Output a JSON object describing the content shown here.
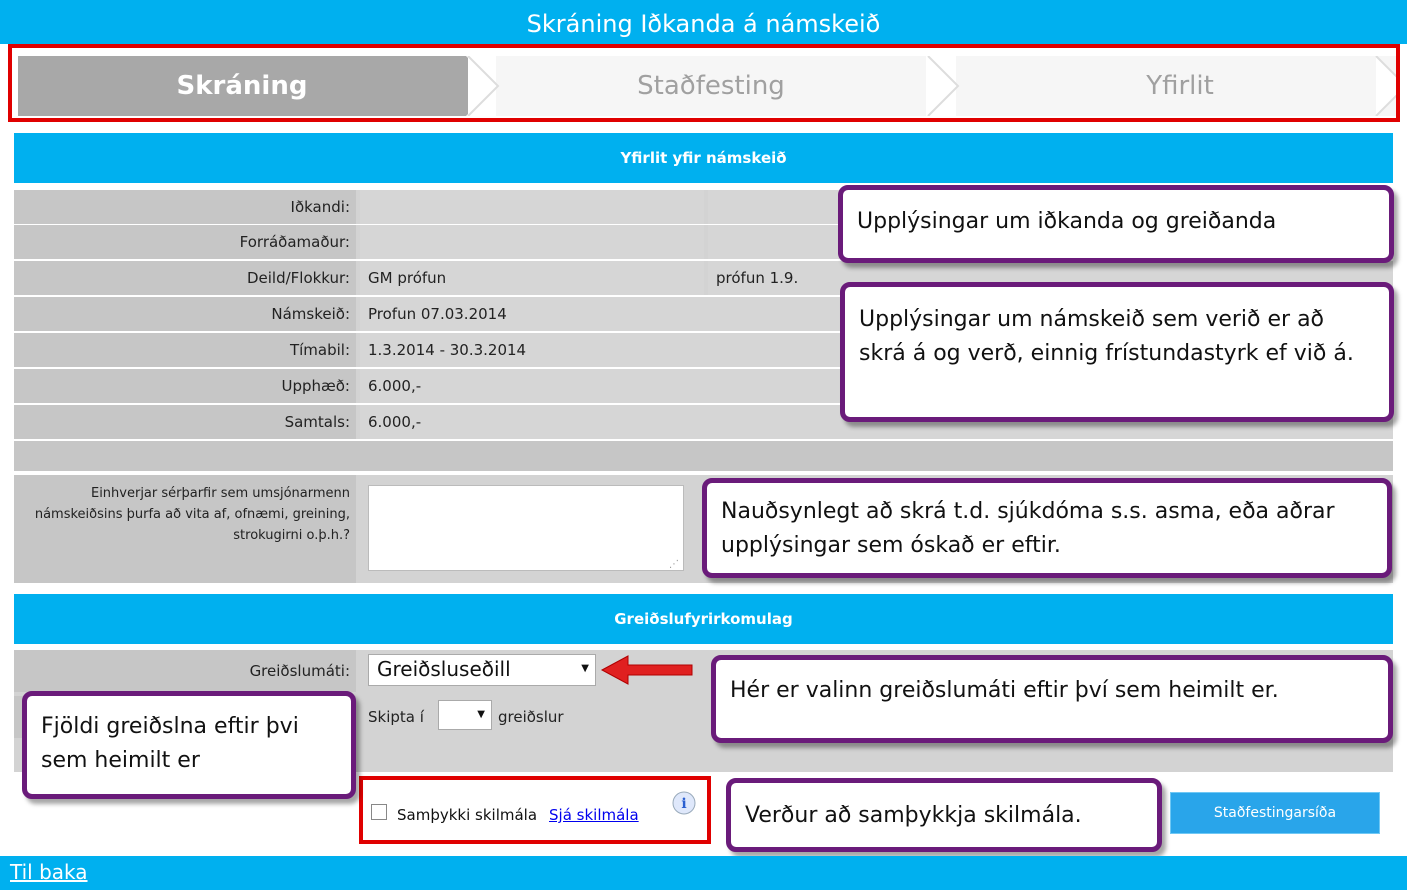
{
  "title": "Skráning Iðkanda á námskeið",
  "steps": [
    "Skráning",
    "Staðfesting",
    "Yfirlit"
  ],
  "section1": "Yfirlit yfir námskeið",
  "rows": [
    {
      "label": "Iðkandi:",
      "value": "",
      "extra": ""
    },
    {
      "label": "Forráðamaður:",
      "value": "",
      "extra": ""
    },
    {
      "label": "Deild/Flokkur:",
      "value": "GM prófun",
      "extra": "prófun 1.9."
    },
    {
      "label": "Námskeið:",
      "value": "Profun 07.03.2014",
      "extra": ""
    },
    {
      "label": "Tímabil:",
      "value": "1.3.2014 - 30.3.2014",
      "extra": ""
    },
    {
      "label": "Upphæð:",
      "value": "6.000,-",
      "extra": ""
    },
    {
      "label": "Samtals:",
      "value": "6.000,-",
      "extra": ""
    }
  ],
  "notes_label": "Einhverjar sérþarfir sem umsjónarmenn námskeiðsins þurfa að vita af, ofnæmi, greining, strokugirni o.þ.h.?",
  "section2": "Greiðslufyrirkomulag",
  "payment_label": "Greiðslumáti:",
  "payment_value": "Greiðsluseðill",
  "split_prefix": "Skipta í",
  "split_suffix": "greiðslur",
  "split_value": "",
  "terms_label": "Samþykki skilmála",
  "terms_link": "Sjá skilmála",
  "confirm_button": "Staðfestingarsíða",
  "back_link": "Til baka",
  "callouts": {
    "c1": "Upplýsingar um iðkanda og greiðanda",
    "c2": "Upplýsingar um námskeið sem verið er að skrá á og verð, einnig frístundastyrk ef við á.",
    "c3": "Nauðsynlegt að skrá t.d. sjúkdóma s.s. asma, eða aðrar upplýsingar sem óskað er eftir.",
    "c4": "Hér er valinn greiðslumáti eftir því sem heimilt er.",
    "c5": "Fjöldi greiðslna eftir þvi sem heimilt er",
    "c6": "Verður að samþykkja skilmála."
  }
}
